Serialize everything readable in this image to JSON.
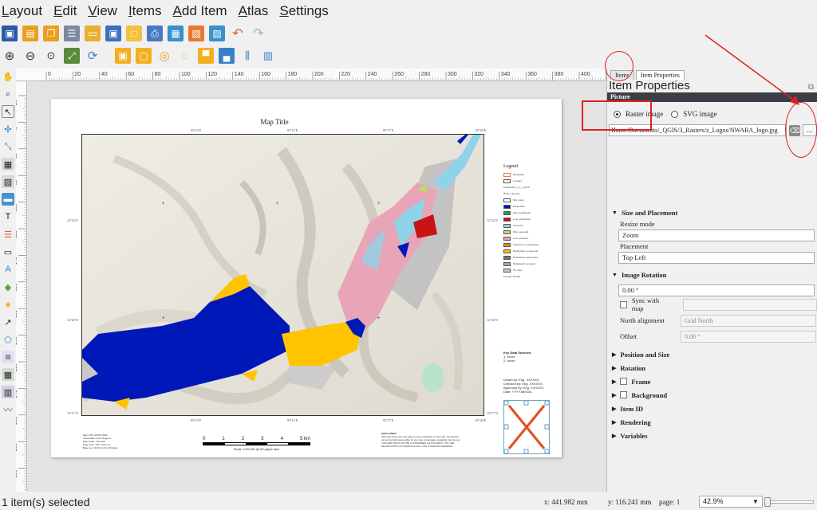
{
  "menu": [
    "Layout",
    "Edit",
    "View",
    "Items",
    "Add Item",
    "Atlas",
    "Settings"
  ],
  "toolbar1_icons": [
    "save-icon",
    "new-layout-icon",
    "duplicate-layout-icon",
    "layout-manager-icon",
    "open-template-icon",
    "save-template-icon",
    "new-page-icon",
    "print-icon",
    "export-image-icon",
    "export-svg-icon",
    "export-pdf-icon",
    "undo-icon",
    "redo-icon"
  ],
  "toolbar2_icons": [
    "zoom-in-icon",
    "zoom-out-icon",
    "zoom-100-icon",
    "zoom-full-icon",
    "refresh-icon",
    "lock-icon",
    "unlock-icon",
    "select-all-icon",
    "deselect-icon",
    "raise-icon",
    "lower-icon",
    "align-icon",
    "distribute-icon"
  ],
  "left_tools": [
    "pan-icon",
    "zoom-tool-icon",
    "select-icon",
    "move-content-icon",
    "edit-nodes-icon",
    "add-map-icon",
    "add-3d-map-icon",
    "add-picture-icon",
    "add-label-icon",
    "add-legend-icon",
    "add-scalebar-icon",
    "add-north-arrow-icon",
    "add-shape-icon",
    "add-marker-icon",
    "add-arrow-icon",
    "add-node-icon",
    "add-html-icon",
    "add-attribute-table-icon",
    "add-fixed-table-icon",
    "add-elevation-profile-icon"
  ],
  "ruler": {
    "h_ticks": [
      "0",
      "20",
      "40",
      "60",
      "80",
      "100",
      "120",
      "140",
      "160",
      "180",
      "200",
      "220",
      "240",
      "260",
      "280",
      "300",
      "320",
      "340",
      "360",
      "380",
      "400",
      "420"
    ],
    "v_ticks": [
      "20",
      "40",
      "60",
      "80",
      "100",
      "120",
      "140",
      "160",
      "180",
      "200",
      "220",
      "240",
      "260",
      "280",
      "300"
    ]
  },
  "layout": {
    "map_title": "Map Title",
    "top_coords": [
      "05°10´E",
      "05°13´E",
      "05°17´E",
      "05°20´E"
    ],
    "left_coords": [
      "12°24´N",
      "12°20´N",
      "12°17´N"
    ],
    "legend": {
      "title": "Legend",
      "items": [
        {
          "label": "sheltesma",
          "color": "#ffffff",
          "border": "#e08040"
        },
        {
          "label": "Country",
          "color": "#ffffff",
          "border": "#555555"
        },
        {
          "label": "Inundation_v1_1_2019",
          "color": null
        },
        {
          "label": "Band 1 (Gray)",
          "color": null
        },
        {
          "label": "Not water",
          "color": "#ffffff"
        },
        {
          "label": "Permanent",
          "color": "#0018b8"
        },
        {
          "label": "New permanent",
          "color": "#1aa32a"
        },
        {
          "label": "Lost permanent",
          "color": "#c81414"
        },
        {
          "label": "Seasonal",
          "color": "#8fd3e8"
        },
        {
          "label": "New seasonal",
          "color": "#b8e060"
        },
        {
          "label": "Lost seasonal",
          "color": "#e8a0b8"
        },
        {
          "label": "Seasonal to permanent",
          "color": "#f08020"
        },
        {
          "label": "Permanent to seasonal",
          "color": "#ffc400"
        },
        {
          "label": "Ephemeral permanent",
          "color": "#707070"
        },
        {
          "label": "Ephemeral seasonal",
          "color": "#a8a8a8"
        },
        {
          "label": "No data",
          "color": "#c8c8c8"
        },
        {
          "label": "Google Terrain",
          "color": null
        }
      ]
    },
    "key_sources": [
      "Key Data Sources:",
      "1. xxxxx",
      "2. xxxxx"
    ],
    "drawn_by": [
      "Drawn by: Eng. XXXXXX,",
      "Checked by: Eng. XXXXXX,",
      "Approved by: Eng. XXXXXX,",
      "Date: YYYY.MM.DD."
    ],
    "scale_labels": [
      "0",
      "1",
      "2",
      "3",
      "4",
      "5 km"
    ],
    "scale_caption": "Scale 1:53,165 @ A3 paper size",
    "crs_lines": [
      "Map CRS: EPSG:4326",
      "Coordinate Units: Degrees",
      "Map Scale: 1:53,165",
      "Page Size: 420 x 297 mm",
      "Base ver. QGIS 3.10 in Windows"
    ],
    "disclaimer_lines": [
      "DISCLAIMER",
      "Although great care was taken in the preparation of this map, the authors",
      "cannot be held responsible for any loss or damage emanating from its use.",
      "THIS MAP MUST NOT BE CONSIDERED AN AUTHORITY ON THE",
      "DELIMITATION OF INTERNATIONAL AND OTHER BOUNDARIES."
    ]
  },
  "panel": {
    "tabs": [
      "Items",
      "Item Properties"
    ],
    "title": "Item Properties",
    "section_header": "Picture",
    "raster_label": "Raster image",
    "svg_label": "SVG image",
    "path_value": "Home/Documents/_QGIS/3_Rasters/z_Logos/NWARA_logo.jpg",
    "dots_label": "...",
    "size_placement": "Size and Placement",
    "resize_mode_label": "Resize mode",
    "resize_mode_value": "Zoom",
    "placement_label": "Placement",
    "placement_value": "Top Left",
    "image_rotation": "Image Rotation",
    "rotation_value": "0.00 °",
    "sync_with_map": "Sync with map",
    "north_alignment": "North alignment",
    "north_value": "Grid North",
    "offset_label": "Offset",
    "offset_value": "0.00 °",
    "collapsed_sections": [
      {
        "label": "Position and Size",
        "checkbox": false
      },
      {
        "label": "Rotation",
        "checkbox": false
      },
      {
        "label": "Frame",
        "checkbox": true
      },
      {
        "label": "Background",
        "checkbox": true
      },
      {
        "label": "Item ID",
        "checkbox": false
      },
      {
        "label": "Rendering",
        "checkbox": false
      },
      {
        "label": "Variables",
        "checkbox": false
      }
    ]
  },
  "status": {
    "selection": "1 item(s) selected",
    "x": "x: 441.982 mm",
    "y": "y: 116.241 mm",
    "page": "page: 1",
    "zoom": "42.9%"
  },
  "colors": {
    "permanent": "#0018b8",
    "permanent_to_seasonal": "#ffc400",
    "annotation": "#e02020",
    "panel_header": "#3b3f45"
  }
}
